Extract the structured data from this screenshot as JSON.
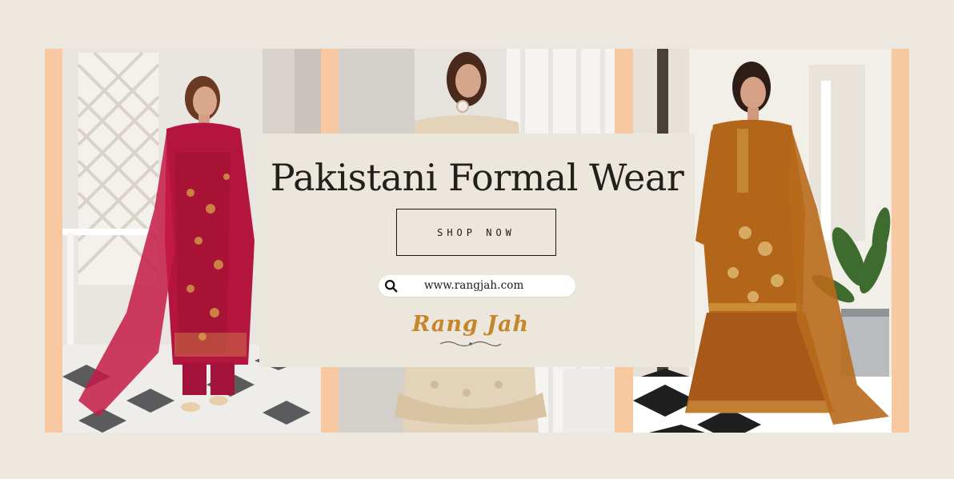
{
  "banner": {
    "headline": "Pakistani Formal Wear",
    "shop_button_label": "SHOP NOW",
    "search_url": "www.rangjah.com",
    "brand_name": "Rang Jah"
  },
  "icons": {
    "search": "search-icon",
    "brand_flourish": "flourish-ornament-icon"
  },
  "colors": {
    "background": "#ede8df",
    "accent_band": "#f8c9a0",
    "card": "#ece7dd",
    "brand": "#c6862b",
    "text": "#231f1c",
    "outfit_left": "#b4153f",
    "outfit_center": "#e3d3b8",
    "outfit_right": "#b3661a"
  }
}
